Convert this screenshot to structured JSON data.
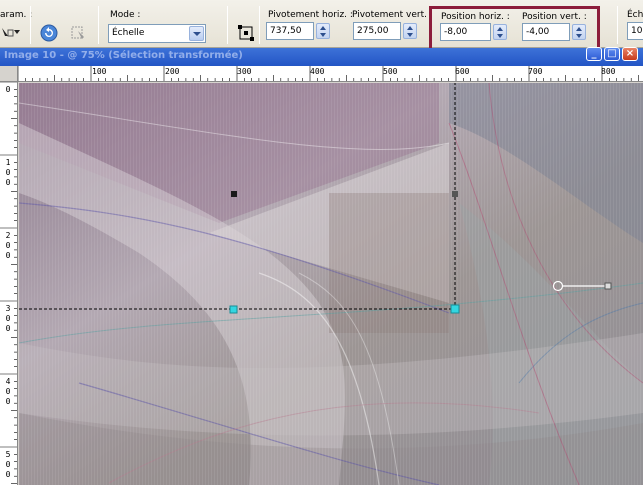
{
  "toolbar": {
    "param_label": "aram. :",
    "mode_label": "Mode :",
    "mode_value": "Échelle",
    "pivot_h_label": "Pivotement horiz. :",
    "pivot_h_value": "737,50",
    "pivot_v_label": "Pivotement vert. :",
    "pivot_v_value": "275,00",
    "pos_h_label": "Position horiz. :",
    "pos_h_value": "-8,00",
    "pos_v_label": "Position vert. :",
    "pos_v_value": "-4,00",
    "scale_label": "Éch",
    "scale_value": "10",
    "highlight_color": "#8c1d3b"
  },
  "window": {
    "title": "Image 10 - @ 75% (Sélection transformée)",
    "minimize": "_",
    "maximize": "□",
    "close": "×"
  },
  "ruler_h": {
    "labels": [
      "100",
      "200",
      "300",
      "400",
      "500",
      "600",
      "700",
      "800"
    ]
  },
  "ruler_v": {
    "labels": [
      "0",
      "100",
      "200",
      "300",
      "400",
      "500"
    ]
  },
  "colors": {
    "selection_handle": "#1a1a1a",
    "active_handle": "#33d6e0",
    "marquee": "#000000"
  }
}
